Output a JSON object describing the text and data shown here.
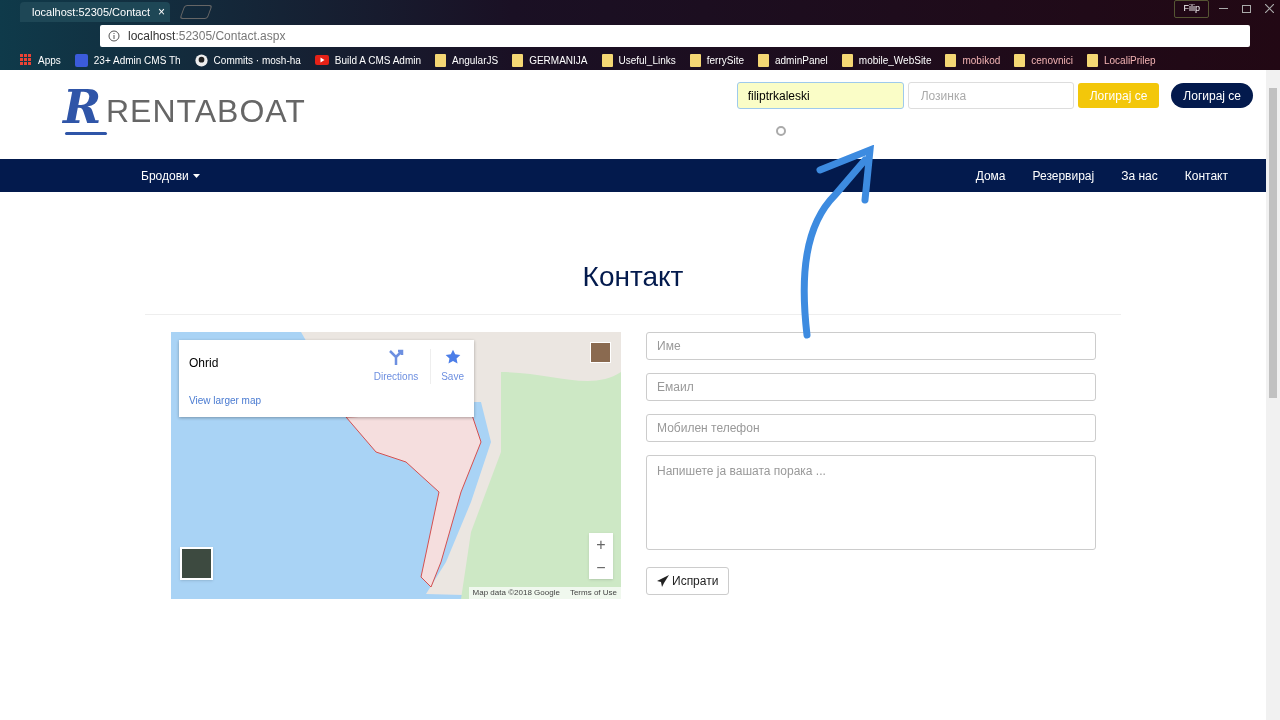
{
  "browser": {
    "tab": {
      "title": "localhost:52305/Contact",
      "close": "×"
    },
    "profile": "Filip",
    "address": {
      "host": "localhost",
      "path": ":52305/Contact.aspx"
    },
    "bookmarks": [
      {
        "label": "Apps",
        "kind": "apps"
      },
      {
        "label": "23+ Admin CMS Th",
        "kind": "letter"
      },
      {
        "label": "Commits · mosh-ha",
        "kind": "github"
      },
      {
        "label": "Build A CMS Admin",
        "kind": "video"
      },
      {
        "label": "AngularJS",
        "kind": "folder"
      },
      {
        "label": "GERMANIJA",
        "kind": "folder"
      },
      {
        "label": "Useful_Links",
        "kind": "folder"
      },
      {
        "label": "ferrySite",
        "kind": "folder"
      },
      {
        "label": "adminPanel",
        "kind": "folder"
      },
      {
        "label": "mobile_WebSite",
        "kind": "folder"
      },
      {
        "label": "mobikod",
        "kind": "folder"
      },
      {
        "label": "cenovnici",
        "kind": "folder"
      },
      {
        "label": "LocaliPrilep",
        "kind": "folder"
      }
    ]
  },
  "header": {
    "logo": {
      "initial": "R",
      "name": "RENTABOAT"
    },
    "login": {
      "username": {
        "value": "filiptrkaleski"
      },
      "password": {
        "placeholder": "Лозинка"
      },
      "buttons": [
        {
          "label": "Логирај се",
          "kind": "warning"
        },
        {
          "label": "Логирај се",
          "kind": "primary"
        }
      ]
    }
  },
  "nav": {
    "left": [
      {
        "label": "Бродови",
        "dropdown": true
      }
    ],
    "right": [
      {
        "label": "Дома"
      },
      {
        "label": "Резервирај"
      },
      {
        "label": "За нас"
      },
      {
        "label": "Контакт"
      }
    ]
  },
  "page": {
    "heading": "Контакт",
    "map": {
      "place": "Ohrid",
      "actions": [
        {
          "label": "Directions",
          "kind": "directions"
        },
        {
          "label": "Save",
          "kind": "save"
        }
      ],
      "link": "View larger map",
      "zoom_in": "+",
      "zoom_out": "−",
      "attribution": "Map data ©2018 Google",
      "terms": "Terms of Use"
    },
    "form": {
      "fields": [
        {
          "placeholder": "Име",
          "kind": "input"
        },
        {
          "placeholder": "Емаил",
          "kind": "input"
        },
        {
          "placeholder": "Мобилен телефон",
          "kind": "input"
        },
        {
          "placeholder": "Напишете ја вашата порака ...",
          "kind": "textarea"
        }
      ],
      "submit": "Испрати"
    }
  }
}
